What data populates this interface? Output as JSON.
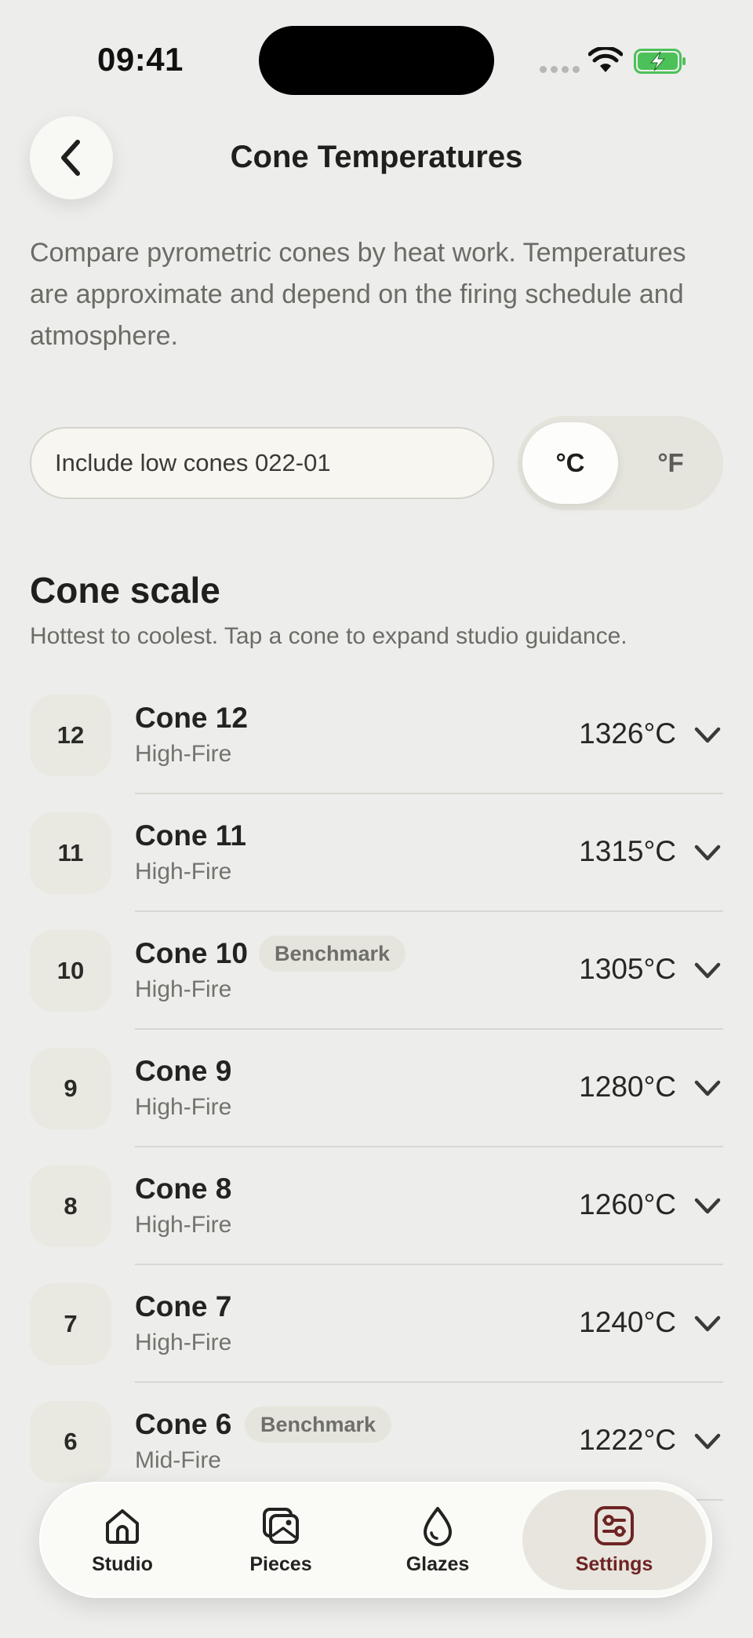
{
  "status_bar": {
    "time": "09:41"
  },
  "header": {
    "title": "Cone Temperatures"
  },
  "intro": "Compare pyrometric cones by heat work. Temperatures are approximate and depend on the firing schedule and atmosphere.",
  "controls": {
    "low_cones_label": "Include low cones 022-01",
    "units": {
      "celsius": "°C",
      "fahrenheit": "°F",
      "selected": "°C"
    }
  },
  "section": {
    "title": "Cone scale",
    "subtitle": "Hottest to coolest. Tap a cone to expand studio guidance."
  },
  "cones": [
    {
      "number": "12",
      "name": "Cone 12",
      "range": "High-Fire",
      "temp": "1326°C",
      "benchmark": ""
    },
    {
      "number": "11",
      "name": "Cone 11",
      "range": "High-Fire",
      "temp": "1315°C",
      "benchmark": ""
    },
    {
      "number": "10",
      "name": "Cone 10",
      "range": "High-Fire",
      "temp": "1305°C",
      "benchmark": "Benchmark"
    },
    {
      "number": "9",
      "name": "Cone 9",
      "range": "High-Fire",
      "temp": "1280°C",
      "benchmark": ""
    },
    {
      "number": "8",
      "name": "Cone 8",
      "range": "High-Fire",
      "temp": "1260°C",
      "benchmark": ""
    },
    {
      "number": "7",
      "name": "Cone 7",
      "range": "High-Fire",
      "temp": "1240°C",
      "benchmark": ""
    },
    {
      "number": "6",
      "name": "Cone 6",
      "range": "Mid-Fire",
      "temp": "1222°C",
      "benchmark": "Benchmark"
    }
  ],
  "tab_bar": {
    "tabs": [
      {
        "label": "Studio",
        "icon": "home-icon"
      },
      {
        "label": "Pieces",
        "icon": "pieces-icon"
      },
      {
        "label": "Glazes",
        "icon": "drop-icon"
      },
      {
        "label": "Settings",
        "icon": "sliders-icon"
      }
    ],
    "active": "Settings",
    "active_color": "#6e2424"
  },
  "colors": {
    "background": "#ededeb",
    "battery": "#4cc159"
  }
}
